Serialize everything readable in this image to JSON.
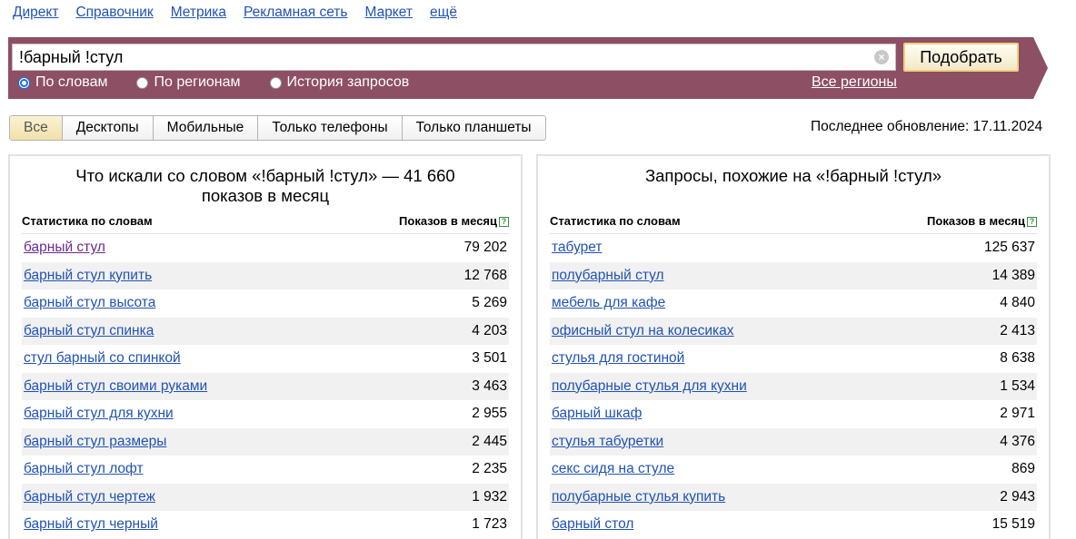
{
  "topnav": [
    "Директ",
    "Справочник",
    "Метрика",
    "Рекламная сеть",
    "Маркет",
    "ещё"
  ],
  "search": {
    "value": "!барный !стул",
    "button": "Подобрать"
  },
  "radios": [
    {
      "label": "По словам",
      "checked": true
    },
    {
      "label": "По регионам",
      "checked": false
    },
    {
      "label": "История запросов",
      "checked": false
    }
  ],
  "all_regions": "Все регионы",
  "tabs": [
    "Все",
    "Десктопы",
    "Мобильные",
    "Только телефоны",
    "Только планшеты"
  ],
  "active_tab": "Все",
  "last_update": "Последнее обновление: 17.11.2024",
  "left": {
    "title": "Что искали со словом «!барный !стул» — 41 660 показов в месяц",
    "col1": "Статистика по словам",
    "col2": "Показов в месяц",
    "rows": [
      {
        "q": "барный стул",
        "n": "79 202"
      },
      {
        "q": "барный стул купить",
        "n": "12 768"
      },
      {
        "q": "барный стул высота",
        "n": "5 269"
      },
      {
        "q": "барный стул спинка",
        "n": "4 203"
      },
      {
        "q": "стул барный со спинкой",
        "n": "3 501"
      },
      {
        "q": "барный стул своими руками",
        "n": "3 463"
      },
      {
        "q": "барный стул для кухни",
        "n": "2 955"
      },
      {
        "q": "барный стул размеры",
        "n": "2 445"
      },
      {
        "q": "барный стул лофт",
        "n": "2 235"
      },
      {
        "q": "барный стул чертеж",
        "n": "1 932"
      },
      {
        "q": "барный стул черный",
        "n": "1 723"
      }
    ]
  },
  "right": {
    "title": "Запросы, похожие на «!барный !стул»",
    "col1": "Статистика по словам",
    "col2": "Показов в месяц",
    "rows": [
      {
        "q": "табурет",
        "n": "125 637"
      },
      {
        "q": "полубарный стул",
        "n": "14 389"
      },
      {
        "q": "мебель для кафе",
        "n": "4 840"
      },
      {
        "q": "офисный стул на колесиках",
        "n": "2 413"
      },
      {
        "q": "стулья для гостиной",
        "n": "8 638"
      },
      {
        "q": "полубарные стулья для кухни",
        "n": "1 534"
      },
      {
        "q": "барный шкаф",
        "n": "2 971"
      },
      {
        "q": "стулья табуретки",
        "n": "4 376"
      },
      {
        "q": "секс сидя на стуле",
        "n": "869"
      },
      {
        "q": "полубарные стулья купить",
        "n": "2 943"
      },
      {
        "q": "барный стол",
        "n": "15 519"
      }
    ]
  },
  "colors": {
    "band": "#8d4f64",
    "link": "#2152b5",
    "visited": "#6b2a8e"
  }
}
